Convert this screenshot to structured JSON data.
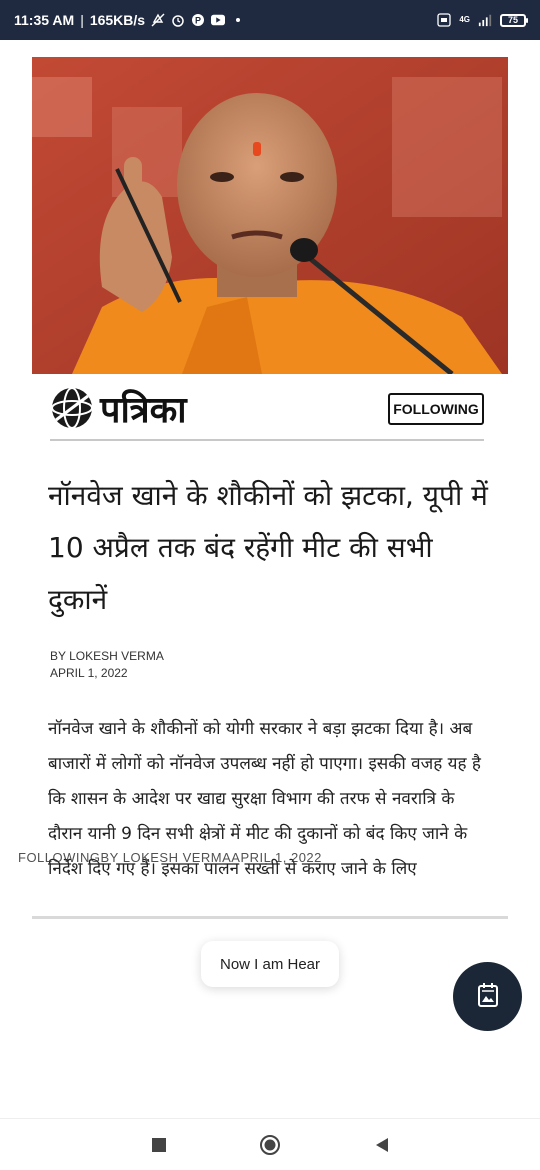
{
  "status_bar": {
    "time": "11:35 AM",
    "network_speed": "165KB/s",
    "net_label": "4G",
    "battery": "75",
    "icons": [
      "no-sound-icon",
      "alarm-icon",
      "app-p-icon",
      "youtube-icon",
      "dot-icon",
      "volte-icon",
      "signal-icon",
      "battery-icon"
    ]
  },
  "article": {
    "brand": "पत्रिका",
    "following_label": "FOLLOWING",
    "headline": "नॉनवेज खाने के शौकीनों को झटका, यूपी में 10 अप्रैल तक बंद रहेंगी मीट की सभी दुकानें",
    "author": "BY LOKESH VERMA",
    "date": "APRIL 1, 2022",
    "body": "नॉनवेज खाने के शौकीनों को योगी सरकार ने बड़ा झटका दिया है। अब बाजारों में लोगों को नॉनवेज उपलब्ध नहीं हो पाएगा। इसकी वजह यह है कि शासन के आदेश पर खाद्य सुरक्षा विभाग की तरफ से नवरात्रि के दौरान यानी 9 दिन सभी क्षेत्रों में मीट की दुकानों को बंद किए जाने के निर्देश दिए गए हैं। इसका पालन सख्ती से कराए जाने के लिए",
    "overlay_caption": "FOLLOWINGBY LOKESH VERMAAPRIL 1, 2022"
  },
  "comment_pill": {
    "label": "Now I am Hear"
  },
  "fab": {
    "icon": "calendar-image-icon"
  },
  "navbar": {
    "icons": [
      "recents-square-icon",
      "home-circle-icon",
      "back-triangle-icon"
    ]
  },
  "colors": {
    "status_bar_bg": "#1f2a40",
    "fab_bg": "#1b2736",
    "photo_bg": "#b9452f",
    "saffron": "#f08a1c"
  }
}
